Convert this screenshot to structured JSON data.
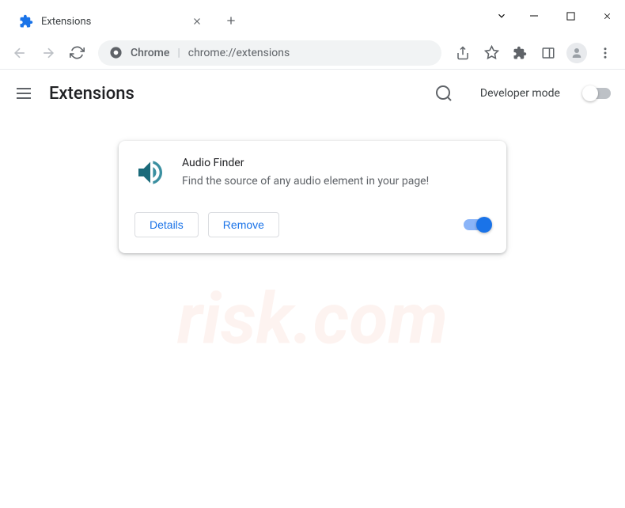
{
  "tab": {
    "title": "Extensions"
  },
  "omnibox": {
    "scheme": "Chrome",
    "url": "chrome://extensions"
  },
  "appHeader": {
    "title": "Extensions",
    "devmode_label": "Developer mode"
  },
  "extension": {
    "name": "Audio Finder",
    "description": "Find the source of any audio element in your page!",
    "details_label": "Details",
    "remove_label": "Remove"
  }
}
